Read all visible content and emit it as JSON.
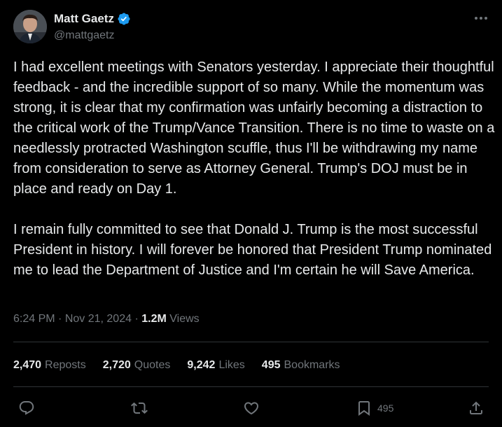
{
  "author": {
    "display_name": "Matt Gaetz",
    "handle": "@mattgaetz",
    "verified_icon": "verified-badge-icon",
    "verified_color": "#1d9bf0"
  },
  "tweet": {
    "text": "I had excellent meetings with Senators yesterday.  I appreciate their thoughtful feedback - and the incredible support of so many.  While the momentum was strong, it is clear that my confirmation was unfairly becoming a distraction to the critical work of the Trump/Vance Transition. There is no time to waste on a needlessly protracted Washington scuffle, thus I'll be withdrawing my name from consideration to serve as Attorney General.  Trump's DOJ must be in place and ready on Day 1.\n\nI remain fully committed to see that Donald J. Trump is the most successful President in history.  I will forever be honored that President Trump nominated me to lead the Department of Justice and I'm certain he will Save America."
  },
  "meta": {
    "time": "6:24 PM",
    "separator": " · ",
    "date": "Nov 21, 2024",
    "views_count": "1.2M",
    "views_label": "Views"
  },
  "stats": {
    "reposts_count": "2,470",
    "reposts_label": "Reposts",
    "quotes_count": "2,720",
    "quotes_label": "Quotes",
    "likes_count": "9,242",
    "likes_label": "Likes",
    "bookmarks_count": "495",
    "bookmarks_label": "Bookmarks"
  },
  "actions": {
    "reply_icon": "reply-icon",
    "retweet_icon": "retweet-icon",
    "like_icon": "heart-icon",
    "bookmark_icon": "bookmark-icon",
    "bookmark_count": "495",
    "share_icon": "share-icon"
  },
  "colors": {
    "background": "#000000",
    "text": "#e7e9ea",
    "secondary": "#71767b",
    "divider": "#2f3336"
  }
}
